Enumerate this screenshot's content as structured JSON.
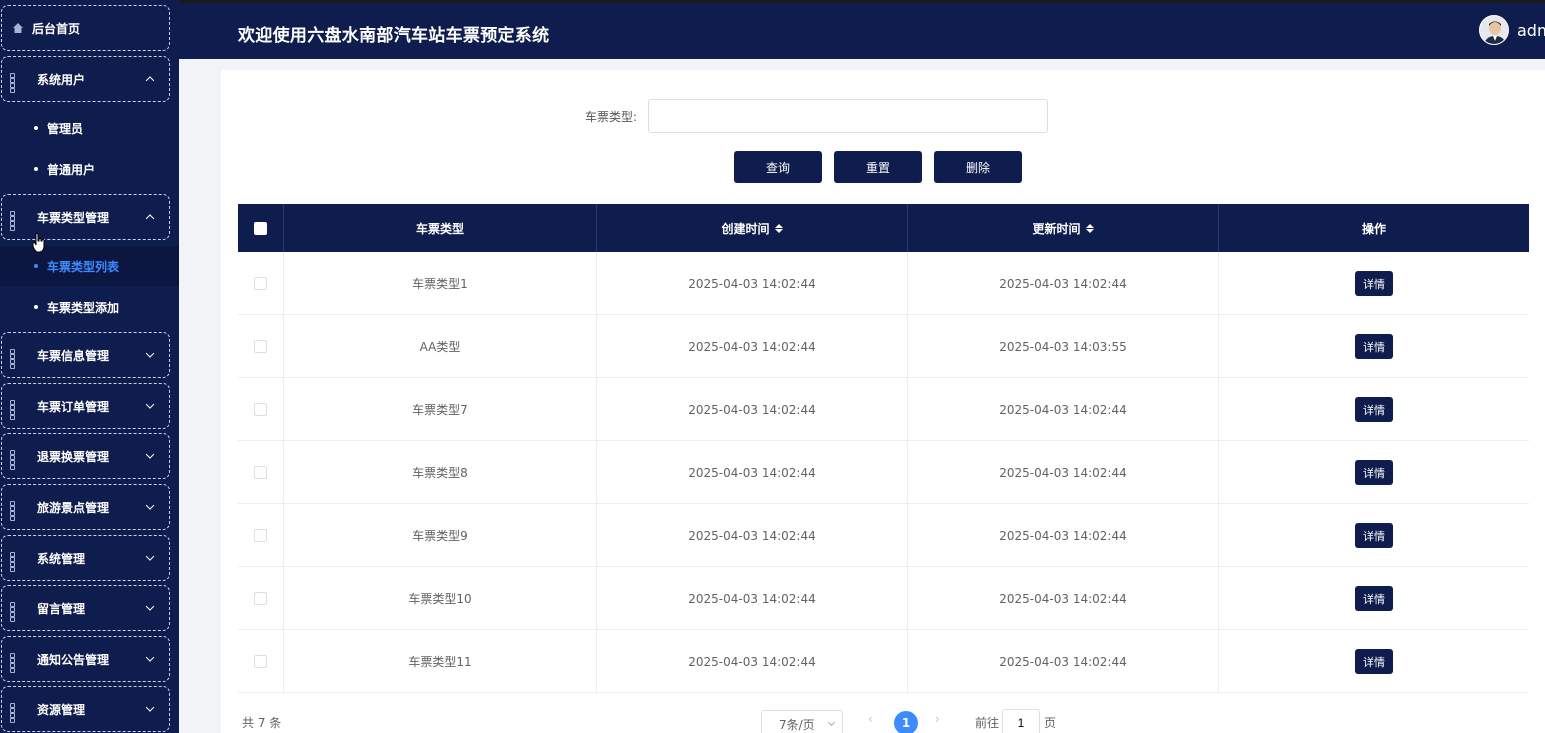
{
  "header": {
    "title": "欢迎使用六盘水南部汽车站车票预定系统",
    "user_name": "adm"
  },
  "sidebar": {
    "home": "后台首页",
    "groups": [
      {
        "label": "系统用户",
        "expanded": true,
        "items": [
          "管理员",
          "普通用户"
        ]
      },
      {
        "label": "车票类型管理",
        "expanded": true,
        "items": [
          "车票类型列表",
          "车票类型添加"
        ],
        "active_item": "车票类型列表"
      },
      {
        "label": "车票信息管理",
        "expanded": false
      },
      {
        "label": "车票订单管理",
        "expanded": false
      },
      {
        "label": "退票换票管理",
        "expanded": false
      },
      {
        "label": "旅游景点管理",
        "expanded": false
      },
      {
        "label": "系统管理",
        "expanded": false
      },
      {
        "label": "留言管理",
        "expanded": false
      },
      {
        "label": "通知公告管理",
        "expanded": false
      },
      {
        "label": "资源管理",
        "expanded": false
      }
    ]
  },
  "search": {
    "label": "车票类型:",
    "value": "",
    "query_btn": "查询",
    "reset_btn": "重置",
    "delete_btn": "删除"
  },
  "table": {
    "columns": [
      "车票类型",
      "创建时间",
      "更新时间",
      "操作"
    ],
    "detail_label": "详情",
    "rows": [
      {
        "type": "车票类型1",
        "created": "2025-04-03 14:02:44",
        "updated": "2025-04-03 14:02:44"
      },
      {
        "type": "AA类型",
        "created": "2025-04-03 14:02:44",
        "updated": "2025-04-03 14:03:55"
      },
      {
        "type": "车票类型7",
        "created": "2025-04-03 14:02:44",
        "updated": "2025-04-03 14:02:44"
      },
      {
        "type": "车票类型8",
        "created": "2025-04-03 14:02:44",
        "updated": "2025-04-03 14:02:44"
      },
      {
        "type": "车票类型9",
        "created": "2025-04-03 14:02:44",
        "updated": "2025-04-03 14:02:44"
      },
      {
        "type": "车票类型10",
        "created": "2025-04-03 14:02:44",
        "updated": "2025-04-03 14:02:44"
      },
      {
        "type": "车票类型11",
        "created": "2025-04-03 14:02:44",
        "updated": "2025-04-03 14:02:44"
      }
    ]
  },
  "pagination": {
    "total": "共 7 条",
    "page_size": "7条/页",
    "prev": "‹",
    "next": "›",
    "current_page": "1",
    "goto_label": "前往",
    "goto_value": "1",
    "page_suffix": "页"
  },
  "colors": {
    "navy": "#0f1d4e",
    "active_blue": "#3e8bff"
  }
}
